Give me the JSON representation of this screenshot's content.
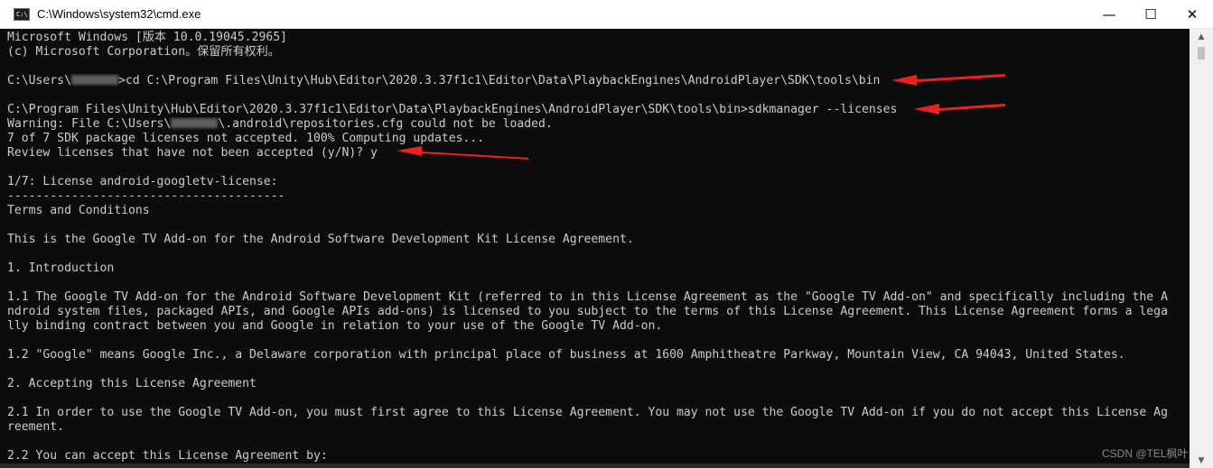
{
  "window": {
    "title": "C:\\Windows\\system32\\cmd.exe",
    "icon_glyph": "C:\\",
    "minimize_glyph": "—",
    "maximize_glyph": "☐",
    "close_glyph": "✕"
  },
  "terminal": {
    "lines": [
      "Microsoft Windows [版本 10.0.19045.2965]",
      "(c) Microsoft Corporation。保留所有权利。",
      "",
      {
        "a": "C:\\Users\\",
        "b": ">cd C:\\Program Files\\Unity\\Hub\\Editor\\2020.3.37f1c1\\Editor\\Data\\PlaybackEngines\\AndroidPlayer\\SDK\\tools\\bin"
      },
      "",
      "C:\\Program Files\\Unity\\Hub\\Editor\\2020.3.37f1c1\\Editor\\Data\\PlaybackEngines\\AndroidPlayer\\SDK\\tools\\bin>sdkmanager --licenses",
      {
        "a": "Warning: File C:\\Users\\",
        "b": "\\.android\\repositories.cfg could not be loaded."
      },
      "7 of 7 SDK package licenses not accepted. 100% Computing updates...",
      "Review licenses that have not been accepted (y/N)? y",
      "",
      "1/7: License android-googletv-license:",
      "---------------------------------------",
      "Terms and Conditions",
      "",
      "This is the Google TV Add-on for the Android Software Development Kit License Agreement.",
      "",
      "1. Introduction",
      "",
      "1.1 The Google TV Add-on for the Android Software Development Kit (referred to in this License Agreement as the \"Google TV Add-on\" and specifically including the A",
      "ndroid system files, packaged APIs, and Google APIs add-ons) is licensed to you subject to the terms of this License Agreement. This License Agreement forms a lega",
      "lly binding contract between you and Google in relation to your use of the Google TV Add-on.",
      "",
      "1.2 \"Google\" means Google Inc., a Delaware corporation with principal place of business at 1600 Amphitheatre Parkway, Mountain View, CA 94043, United States.",
      "",
      "2. Accepting this License Agreement",
      "",
      "2.1 In order to use the Google TV Add-on, you must first agree to this License Agreement. You may not use the Google TV Add-on if you do not accept this License Ag",
      "reement.",
      "",
      "2.2 You can accept this License Agreement by:"
    ]
  },
  "watermark": "CSDN @TEL枫叶",
  "colors": {
    "annotation_arrow": "#e8231f",
    "terminal_bg": "#0c0c0c",
    "terminal_fg": "#cccccc"
  }
}
